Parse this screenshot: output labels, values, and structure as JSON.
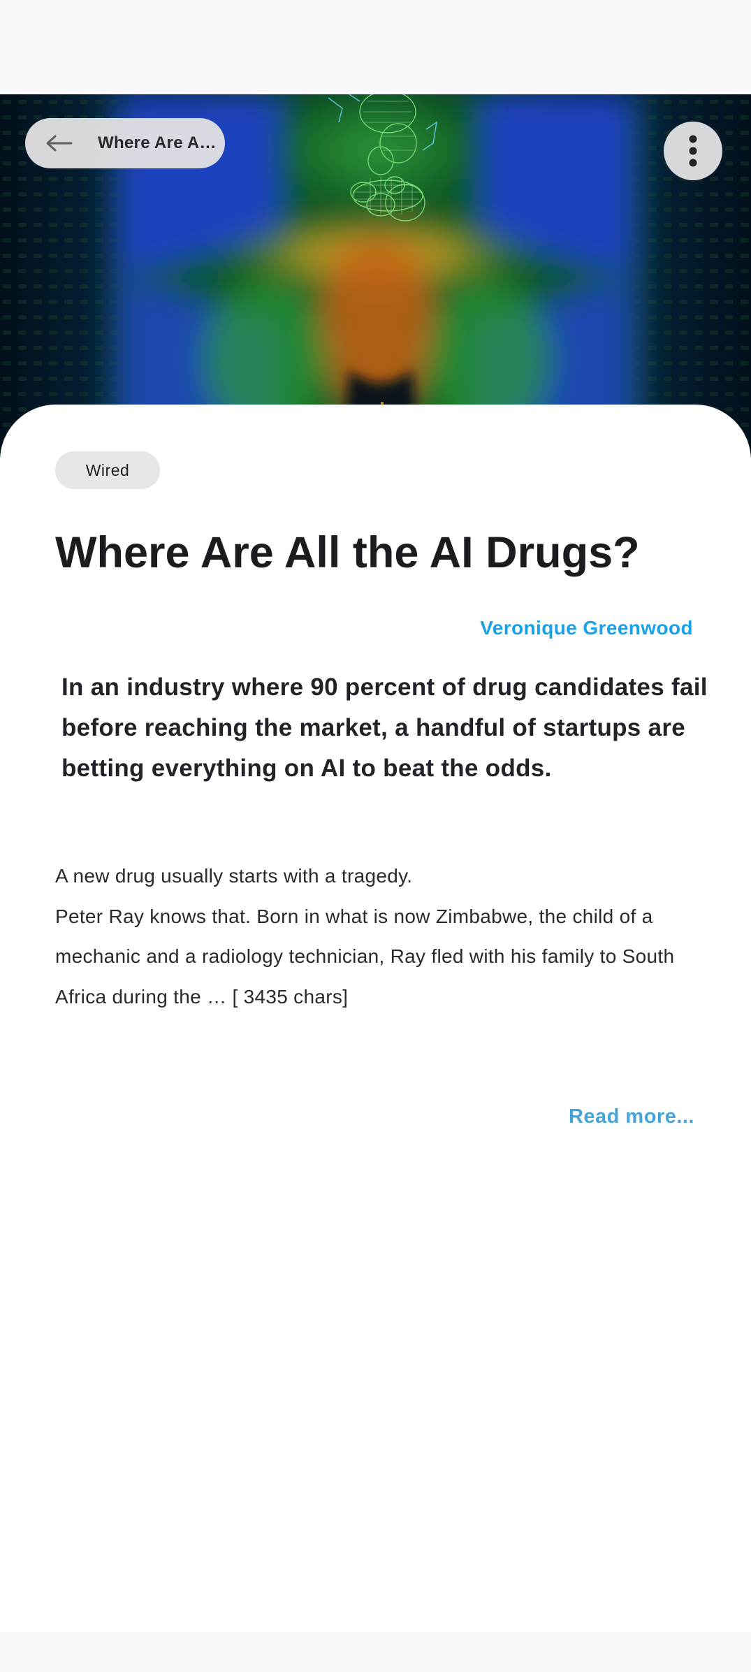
{
  "header": {
    "back_label": "Where Are A…"
  },
  "hero": {
    "image": "molecule-glow-illustration"
  },
  "article": {
    "source": "Wired",
    "title": "Where Are All the AI Drugs?",
    "author": "Veronique Greenwood",
    "lead": "In an industry where 90 percent of drug candidates fail before reaching the market, a handful of startups are betting everything on AI to beat the odds.",
    "body_line1": "A new drug usually starts with a tragedy.",
    "body_line2": "Peter Ray knows that. Born in what is now Zimbabwe, the child of a mechanic and a radiology technician, Ray fled with his family to South Africa during the … [ 3435 chars]",
    "read_more": "Read more..."
  },
  "icons": {
    "back": "arrow-left-icon",
    "menu": "more-vert-icon"
  },
  "colors": {
    "accent": "#18a3e8",
    "read_more": "#4aa3d6",
    "background": "#f8f8fd",
    "pill": "#e0e0e2"
  }
}
